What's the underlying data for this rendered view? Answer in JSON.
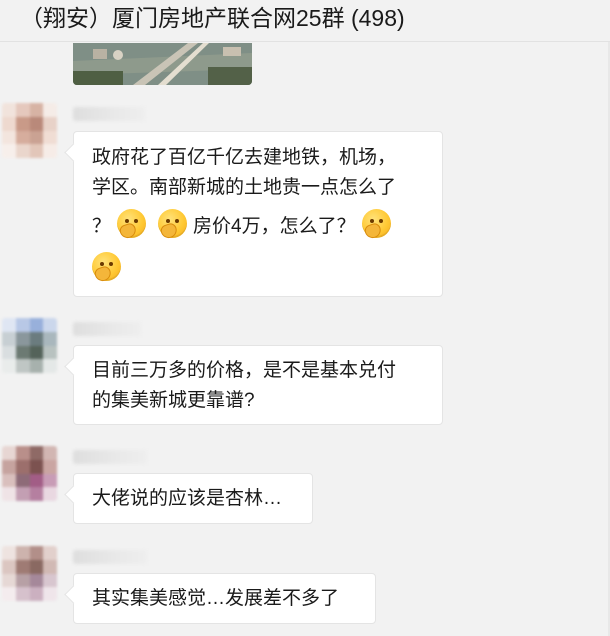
{
  "window": {
    "title": "（翔安）厦门房地产联合网25群 (498)"
  },
  "messages": [
    {
      "type": "image",
      "icon": "shared-image"
    },
    {
      "type": "text",
      "lines": [
        [
          "政府花了百亿千亿去建地铁，机场，"
        ],
        [
          "学区。南部新城的土地贵一点怎么了"
        ],
        [
          "？",
          "emoji:thinking",
          "emoji:thinking",
          "房价4万，怎么了？",
          "emoji:thinking"
        ],
        [
          "emoji:thinking"
        ]
      ],
      "text_parts": {
        "l1": "政府花了百亿千亿去建地铁，机场，",
        "l2": "学区。南部新城的土地贵一点怎么了",
        "l3a": "？",
        "l3b": "房价4万，怎么了？"
      },
      "avatar_colors": [
        "#f1e3dc",
        "#e5c8bd",
        "#d7b3a4",
        "#f5ece7",
        "#eed9cf",
        "#c99a88",
        "#b9897a",
        "#e8d2c8",
        "#f3e5de",
        "#d6ad9d",
        "#caa293",
        "#f0ddd4",
        "#f7efeb",
        "#ead6cc",
        "#e2c6b9",
        "#f6ece7"
      ]
    },
    {
      "type": "text",
      "text_parts": {
        "l1": "目前三万多的价格，是不是基本兑付",
        "l2": "的集美新城更靠谱?"
      },
      "avatar_colors": [
        "#dfe6f3",
        "#b8c8e6",
        "#98b0db",
        "#cbd7ec",
        "#c7cfd3",
        "#8a979c",
        "#6b7c7f",
        "#a9b7bd",
        "#d9dee0",
        "#6c7a73",
        "#54635a",
        "#b8c2c0",
        "#e9eceb",
        "#bfc6c4",
        "#a7b1ad",
        "#e4e8e7"
      ]
    },
    {
      "type": "text",
      "text_parts": {
        "l1": "大佬说的应该是杏林…"
      },
      "avatar_colors": [
        "#e7d6d3",
        "#b98f8a",
        "#8f6a66",
        "#d2b6b2",
        "#c6a39f",
        "#9c6f6c",
        "#7c5250",
        "#caa5a2",
        "#d9bfbd",
        "#8e6b78",
        "#a25d86",
        "#c89cb6",
        "#efe3e6",
        "#c39fb3",
        "#b57fa0",
        "#e9d8e1"
      ]
    },
    {
      "type": "text",
      "text_parts": {
        "l1": "其实集美感觉…发展差不多了"
      },
      "avatar_colors": [
        "#eee3e0",
        "#cdb3ad",
        "#b28f89",
        "#e2d0cc",
        "#dbc6c1",
        "#9f7b74",
        "#8a6962",
        "#d1b9b4",
        "#e6d8d5",
        "#b7a0a5",
        "#a5889a",
        "#d8c6cf",
        "#f4ecee",
        "#d6c1cc",
        "#cbb0c0",
        "#efe5ea"
      ]
    }
  ],
  "colors": {
    "background": "#f2f2f2",
    "bubble": "#ffffff",
    "bubble_border": "#e4e4e4",
    "text": "#1a1a1a"
  }
}
